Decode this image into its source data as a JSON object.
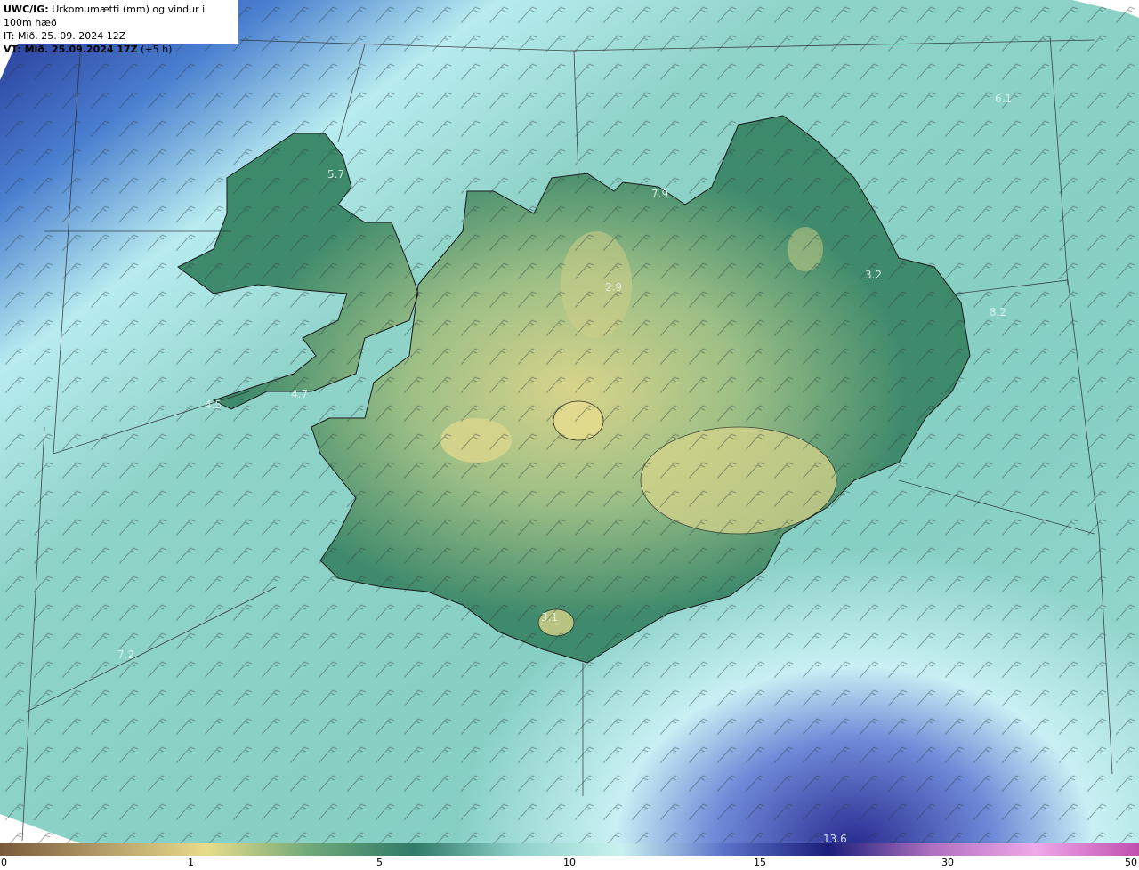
{
  "header": {
    "model_label": "UWC/IG:",
    "description": "Úrkomumætti (mm) og vindur i 100m hæð",
    "init_label": "IT:",
    "init_time": "Mið. 25. 09. 2024 12Z",
    "valid_label": "VT:",
    "valid_time": "Mið. 25.09.2024 17Z",
    "lead": "(+5 h)"
  },
  "map_values": [
    "5.7",
    "7.9",
    "2.9",
    "3.2",
    "8.2",
    "6.1",
    "4.7",
    "4.5",
    "7.2",
    "3.1",
    "13.6"
  ],
  "colorbar": {
    "ticks": [
      "0",
      "1",
      "5",
      "10",
      "15",
      "30",
      "50"
    ],
    "colors": [
      "#7a5a3a",
      "#b39d68",
      "#e8dc8a",
      "#6fa879",
      "#2f7a68",
      "#8fd0c8",
      "#c8f2f0",
      "#5a72c8",
      "#1a1e7a",
      "#b070c0",
      "#f0a8e8",
      "#c04fb0"
    ]
  }
}
